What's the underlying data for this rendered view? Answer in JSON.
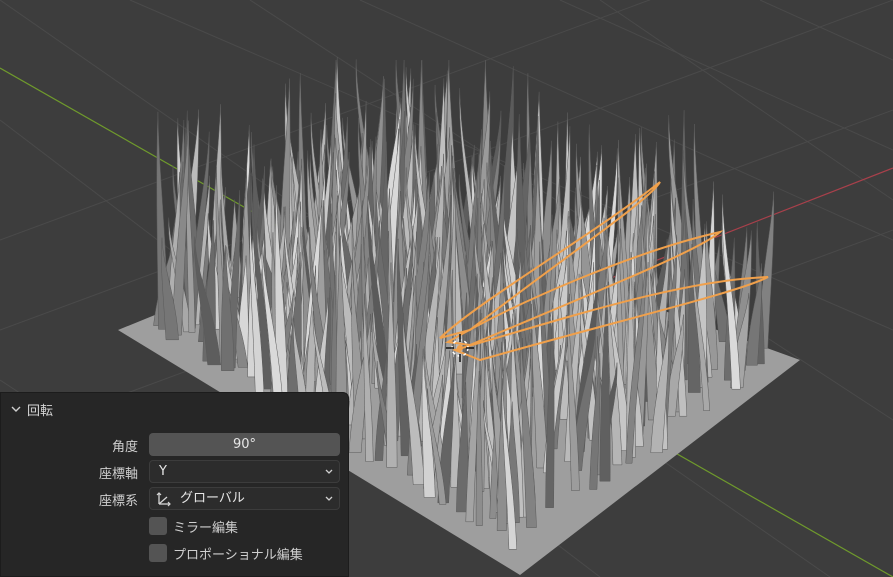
{
  "operator_panel": {
    "title": "回転",
    "angle": {
      "label": "角度",
      "value": "90°"
    },
    "axis": {
      "label": "座標軸",
      "value": "Y"
    },
    "orientation": {
      "label": "座標系",
      "value": "グローバル",
      "icon": "transform-orientation-icon"
    },
    "mirror_edit": {
      "label": "ミラー編集",
      "checked": false
    },
    "proportional_edit": {
      "label": "プロポーショナル編集",
      "checked": false
    }
  },
  "viewport": {
    "background_color": "#3d3d3d",
    "grid_color": "#4a4a4a",
    "x_axis_color": "#a8404b",
    "y_axis_color": "#6f9a2c",
    "selection_color": "#f0a04b",
    "ground_color": "#9c9c9c"
  }
}
